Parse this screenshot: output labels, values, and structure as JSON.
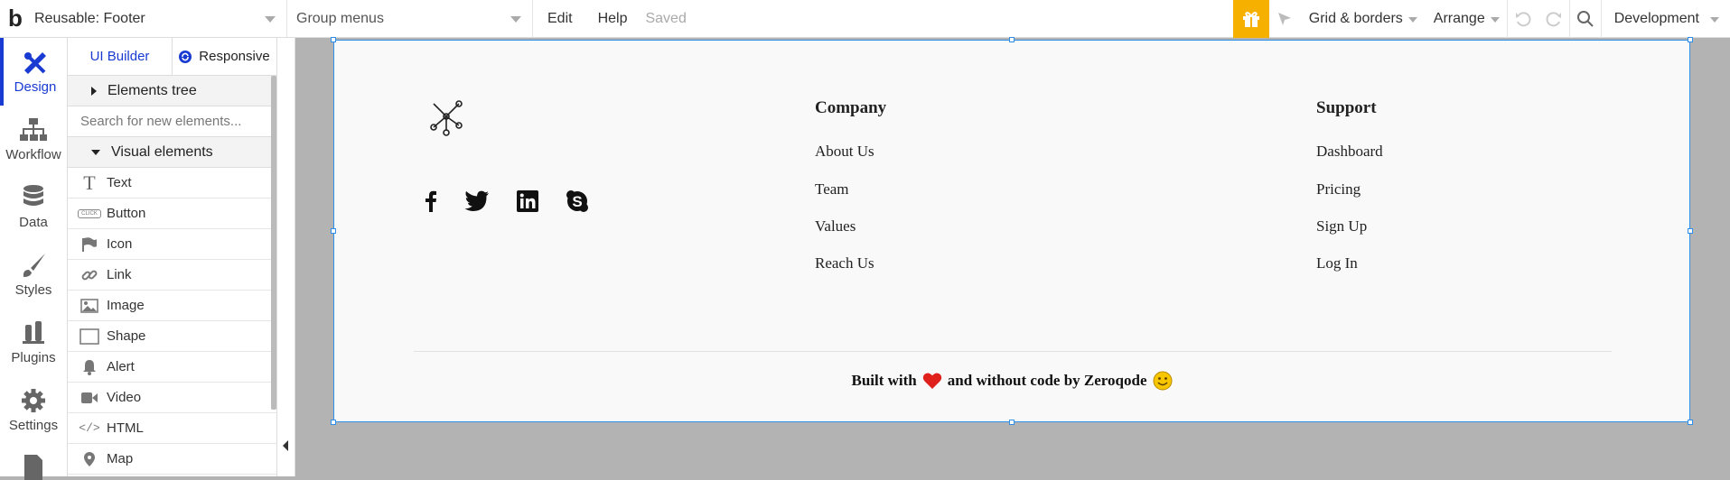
{
  "topbar": {
    "logo": "b",
    "page_select": "Reusable: Footer",
    "group_select": "Group menus",
    "menu": [
      "Edit",
      "Help"
    ],
    "status": "Saved",
    "grid_label": "Grid & borders",
    "arrange_label": "Arrange",
    "env_label": "Development",
    "accent": "#f6b000"
  },
  "rail": {
    "items": [
      {
        "label": "Design",
        "icon": "design-icon"
      },
      {
        "label": "Workflow",
        "icon": "workflow-icon"
      },
      {
        "label": "Data",
        "icon": "database-icon"
      },
      {
        "label": "Styles",
        "icon": "brush-icon"
      },
      {
        "label": "Plugins",
        "icon": "plug-icon"
      },
      {
        "label": "Settings",
        "icon": "gear-icon"
      }
    ],
    "accent": "#1a3bd1"
  },
  "panel": {
    "tab_ui_builder": "UI Builder",
    "tab_responsive": "Responsive",
    "elements_tree": "Elements tree",
    "search_placeholder": "Search for new elements...",
    "visual_elements": "Visual elements",
    "elements": [
      {
        "label": "Text",
        "icon": "text-icon"
      },
      {
        "label": "Button",
        "icon": "button-icon"
      },
      {
        "label": "Icon",
        "icon": "flag-icon"
      },
      {
        "label": "Link",
        "icon": "link-icon"
      },
      {
        "label": "Image",
        "icon": "image-icon"
      },
      {
        "label": "Shape",
        "icon": "shape-icon"
      },
      {
        "label": "Alert",
        "icon": "bell-icon"
      },
      {
        "label": "Video",
        "icon": "video-icon"
      },
      {
        "label": "HTML",
        "icon": "code-icon"
      },
      {
        "label": "Map",
        "icon": "map-pin-icon"
      }
    ],
    "button_badge": "CLICK"
  },
  "footer": {
    "company_title": "Company",
    "company_links": [
      "About Us",
      "Team",
      "Values",
      "Reach Us"
    ],
    "support_title": "Support",
    "support_links": [
      "Dashboard",
      "Pricing",
      "Sign Up",
      "Log In"
    ],
    "credit_before": "Built with",
    "credit_after": "and without code by Zeroqode",
    "heart_color": "#e0201b",
    "smile_color": "#f7c600"
  }
}
